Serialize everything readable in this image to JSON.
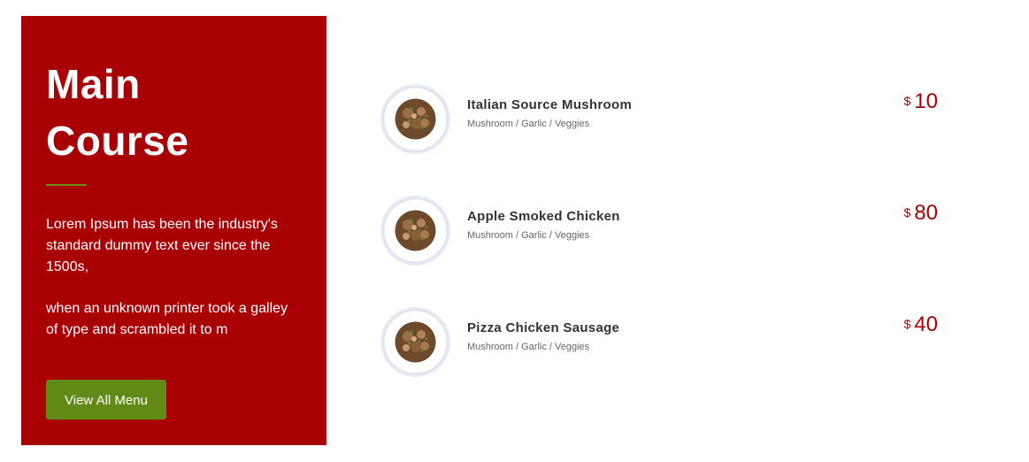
{
  "section": {
    "title_line1": "Main",
    "title_line2": "Course",
    "paragraph1": "Lorem Ipsum has been the industry's standard dummy text ever since the 1500s,",
    "paragraph2": "when an unknown printer took a galley of type and scrambled it to m",
    "button_label": "View All Menu"
  },
  "colors": {
    "panel_bg": "#a90006",
    "accent_green": "#628a16",
    "price_red": "#a90006"
  },
  "menu": {
    "items": [
      {
        "name": "Italian Source Mushroom",
        "ingredients": "Mushroom / Garlic / Veggies",
        "currency": "$",
        "price": "10",
        "image_icon": "mushroom-dish-icon"
      },
      {
        "name": "Apple Smoked Chicken",
        "ingredients": "Mushroom / Garlic / Veggies",
        "currency": "$",
        "price": "80",
        "image_icon": "mushroom-dish-icon"
      },
      {
        "name": "Pizza Chicken Sausage",
        "ingredients": "Mushroom / Garlic / Veggies",
        "currency": "$",
        "price": "40",
        "image_icon": "mushroom-dish-icon"
      }
    ]
  }
}
